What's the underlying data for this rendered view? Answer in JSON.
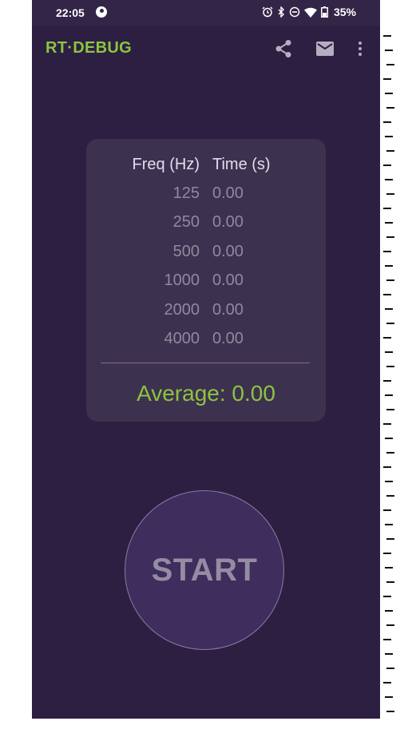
{
  "colors": {
    "accent": "#8dc43f",
    "background": "#2c1f42",
    "card": "#3d3150",
    "button": "#3f2d5e"
  },
  "status_bar": {
    "time": "22:05",
    "battery": "35%",
    "icons": [
      "app-notification-icon",
      "alarm-icon",
      "bluetooth-icon",
      "do-not-disturb-icon",
      "wifi-icon",
      "battery-icon"
    ]
  },
  "toolbar": {
    "title": "RT·DEBUG",
    "actions": [
      "share-icon",
      "mail-icon",
      "more-vert-icon"
    ]
  },
  "results": {
    "headers": {
      "freq": "Freq (Hz)",
      "time": "Time (s)"
    },
    "rows": [
      {
        "freq": "125",
        "time": "0.00"
      },
      {
        "freq": "250",
        "time": "0.00"
      },
      {
        "freq": "500",
        "time": "0.00"
      },
      {
        "freq": "1000",
        "time": "0.00"
      },
      {
        "freq": "2000",
        "time": "0.00"
      },
      {
        "freq": "4000",
        "time": "0.00"
      }
    ],
    "average": "Average: 0.00"
  },
  "start_button": {
    "label": "START"
  }
}
